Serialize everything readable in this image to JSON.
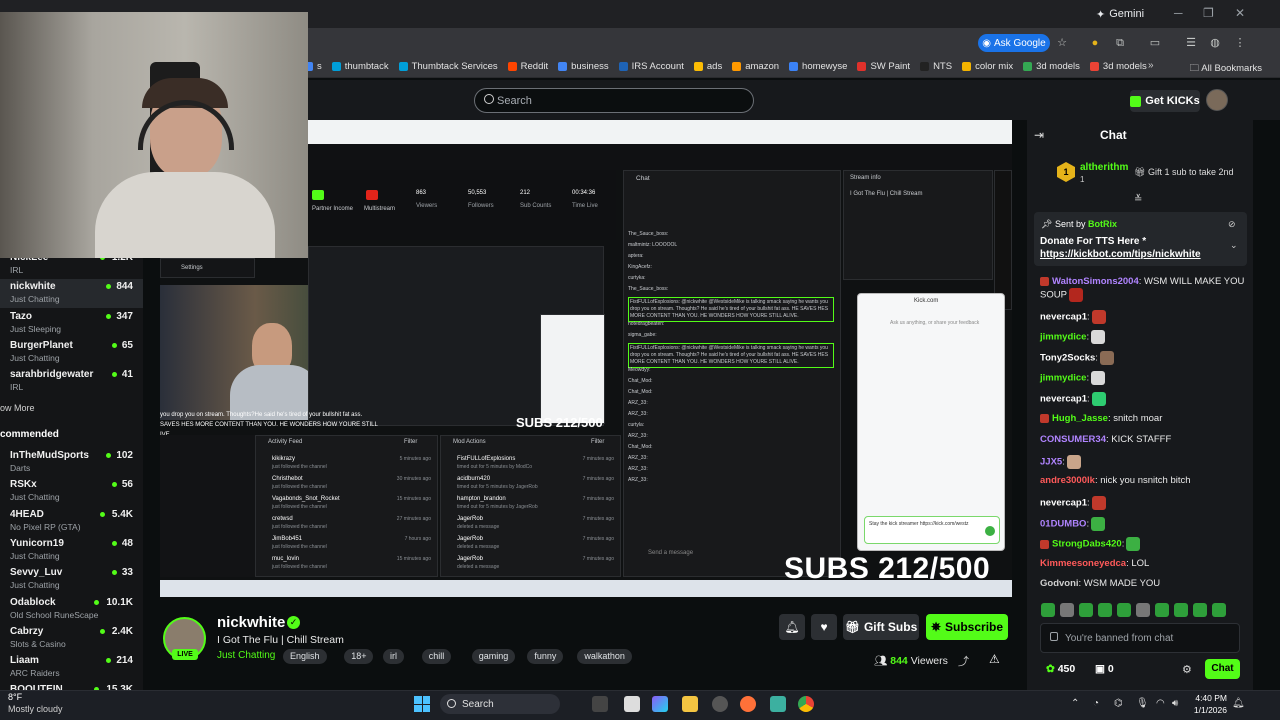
{
  "browser": {
    "gemini": "Gemini",
    "ask_google": "Ask Google",
    "bookmarks": [
      {
        "label": "s",
        "color": "#4285f4"
      },
      {
        "label": "thumbtack",
        "color": "#009fd9"
      },
      {
        "label": "Thumbtack Services",
        "color": "#009fd9"
      },
      {
        "label": "Reddit",
        "color": "#ff4500"
      },
      {
        "label": "business",
        "color": "#4285f4"
      },
      {
        "label": "IRS Account",
        "color": "#1e63b5"
      },
      {
        "label": "ads",
        "color": "#fbbc04"
      },
      {
        "label": "amazon",
        "color": "#ff9900"
      },
      {
        "label": "homewyse",
        "color": "#3b82f6"
      },
      {
        "label": "SW Paint",
        "color": "#e0312b"
      },
      {
        "label": "NTS",
        "color": "#222222"
      },
      {
        "label": "color mix",
        "color": "#f4b400"
      },
      {
        "label": "3d models",
        "color": "#34a853"
      },
      {
        "label": "3d models",
        "color": "#ea4335"
      }
    ],
    "all_bookmarks": "All Bookmarks"
  },
  "header": {
    "search_placeholder": "Search",
    "get_kicks": "Get KICKs"
  },
  "sidebar": {
    "following": [
      {
        "name": "NickLee",
        "category": "IRL",
        "viewers": "1.2K"
      },
      {
        "name": "nickwhite",
        "category": "Just Chatting",
        "viewers": "844"
      },
      {
        "name": "Tazo",
        "category": "Just Sleeping",
        "viewers": "347"
      },
      {
        "name": "BurgerPlanet",
        "category": "Just Chatting",
        "viewers": "65"
      },
      {
        "name": "sarahbridgewater",
        "category": "IRL",
        "viewers": "41"
      }
    ],
    "show_more": "ow More",
    "recommended_title": "commended",
    "recommended": [
      {
        "name": "InTheMudSports",
        "category": "Darts",
        "viewers": "102"
      },
      {
        "name": "RSKx",
        "category": "Just Chatting",
        "viewers": "56"
      },
      {
        "name": "4HEAD",
        "category": "No Pixel RP (GTA)",
        "viewers": "5.4K"
      },
      {
        "name": "Yunicorn19",
        "category": "Just Chatting",
        "viewers": "48"
      },
      {
        "name": "Sevvy_Luv",
        "category": "Just Chatting",
        "viewers": "33"
      },
      {
        "name": "Odablock",
        "category": "Old School RuneScape",
        "viewers": "10.1K"
      },
      {
        "name": "Cabrzy",
        "category": "Slots & Casino",
        "viewers": "2.4K"
      },
      {
        "name": "Liaam",
        "category": "ARC Raiders",
        "viewers": "214"
      },
      {
        "name": "BOOUTEIN",
        "category": "",
        "viewers": "15.3K"
      }
    ]
  },
  "video": {
    "subs_overlay": "SUBS 212/500",
    "subs_small": "SUBS 212/500",
    "stats": [
      {
        "value": "863",
        "label": "Viewers"
      },
      {
        "value": "50,553",
        "label": "Followers"
      },
      {
        "value": "212",
        "label": "Sub Counts"
      },
      {
        "value": "00:34:36",
        "label": "Time Live"
      }
    ],
    "partner_income": "Partner Income",
    "multistream": "Multistream",
    "settings": "Settings",
    "activity_feed": "Activity Feed",
    "mod_actions": "Mod Actions",
    "filter": "Filter",
    "chat": "Chat",
    "stream_info": "Stream info",
    "stream_info_title": "I Got The Flu | Chill Stream",
    "popup_url": "Kick.com",
    "popup_placeholder": "Ask us anything, or share your feedback",
    "popup_input": "Stay the kick streamer https://kick.com/westz",
    "send_message": "Send a message",
    "activity": [
      {
        "user": "kikikrazy",
        "action": "just followed the channel",
        "time": "5 minutes ago"
      },
      {
        "user": "Christhebot",
        "action": "just followed the channel",
        "time": "30 minutes ago"
      },
      {
        "user": "Vagabonds_Snot_Rocket",
        "action": "just followed the channel",
        "time": "15 minutes ago"
      },
      {
        "user": "cretwsd",
        "action": "just followed the channel",
        "time": "27 minutes ago"
      },
      {
        "user": "JimBob451",
        "action": "just followed the channel",
        "time": "7 hours ago"
      },
      {
        "user": "muc_lovin",
        "action": "just followed the channel",
        "time": "15 minutes ago"
      }
    ],
    "mod_log": [
      {
        "user": "FistFULLofExplosions",
        "action": "timed out for 5 minutes by ModCo",
        "time": "7 minutes ago"
      },
      {
        "user": "acidburn420",
        "action": "timed out for 5 minutes by JagerRob",
        "time": "7 minutes ago"
      },
      {
        "user": "hampton_brandon",
        "action": "timed out for 5 minutes by JagerRob",
        "time": "7 minutes ago"
      },
      {
        "user": "JagerRob",
        "action": "deleted a message",
        "time": "7 minutes ago"
      },
      {
        "user": "JagerRob",
        "action": "deleted a message",
        "time": "7 minutes ago"
      },
      {
        "user": "JagerRob",
        "action": "deleted a message",
        "time": "7 minutes ago"
      }
    ],
    "overlay_text_1": "you drop you on stream. Thoughts?He said he's tired of your bullshit fat ass.",
    "overlay_text_2": "SAVES HES MORE CONTENT THAN YOU. HE WONDERS HOW YOURE STILL",
    "overlay_text_3": "IVE.",
    "inner_chat": [
      "The_Sauce_boss:",
      "maltmintz: LOOOOOL",
      "aptera:",
      "KingAcefz:",
      "curtyka:",
      "The_Sauce_boss:",
      "FistFULLofExplosions: @nickwhite @WestsideMike is talking smack saying he wants you drop you on stream. Thoughts? He said he's tired of your bullshit fat ass. HE SAVES HES MORE CONTENT THAN YOU. HE WONDERS HOW YOURE STILL ALIVE.",
      "notedragbeaten:",
      "sigma_gabe:",
      "FistFULLofExplosions: @nickwhite @WestsideMike is talking smack saying he wants you drop you on stream. Thoughts? He said he's tired of your bullshit fat ass. HE SAVES HES MORE CONTENT THAN YOU. HE WONDERS HOW YOURE STILL ALIVE.",
      "Meowdyy:",
      "Chat_Mod:",
      "Chat_Mod:",
      "ARZ_33:",
      "ARZ_33:",
      "curtyla:",
      "ARZ_33:",
      "Chat_Mod:",
      "ARZ_33:",
      "ARZ_33:",
      "ARZ_33:"
    ]
  },
  "stream": {
    "live_badge": "LIVE",
    "streamer": "nickwhite",
    "title": "I Got The Flu | Chill Stream",
    "category": "Just Chatting",
    "tags": [
      "English",
      "18+",
      "irl",
      "chill",
      "gaming",
      "funny",
      "walkathon"
    ],
    "gift_subs": "Gift Subs",
    "subscribe": "Subscribe",
    "viewer_count": "844",
    "viewers_label": "Viewers"
  },
  "chat": {
    "title": "Chat",
    "gifter_name": "altherithm",
    "gifter_rank": "1",
    "gifter_count": "1",
    "gift_text": "Gift 1 sub to take 2nd",
    "pinned_sent_by": "Sent by",
    "pinned_bot": "BotRix",
    "pinned_line1": "Donate For TTS Here *",
    "pinned_line2": "https://kickbot.com/tips/nickwhite",
    "messages": [
      {
        "user": "WaltonSimons2004",
        "text": ": WSM WILL MAKE YOU SOUP",
        "color": "#b084ff",
        "emote": "#b3271e"
      },
      {
        "user": "nevercap1",
        "text": ":",
        "color": "#ffffff",
        "emote": "#c0392b"
      },
      {
        "user": "jimmydice",
        "text": ":",
        "color": "#53fc18",
        "emote": "#d9d9d9"
      },
      {
        "user": "Tony2Socks",
        "text": ":",
        "color": "#ffffff",
        "emote": "#8a6b55"
      },
      {
        "user": "jimmydice",
        "text": ":",
        "color": "#53fc18",
        "emote": "#d9d9d9"
      },
      {
        "user": "nevercap1",
        "text": ":",
        "color": "#ffffff",
        "emote": "#2ecc71"
      },
      {
        "user": "Hugh_Jasse",
        "text": ": snitch moar",
        "color": "#53fc18",
        "emote": ""
      },
      {
        "user": "CONSUMER34",
        "text": ": KICK STAFFF",
        "color": "#b084ff",
        "emote": ""
      },
      {
        "user": "JJX5",
        "text": ":",
        "color": "#b084ff",
        "emote": "#c9a58a"
      },
      {
        "user": "andre3000lk",
        "text": ": nick you nsnitch bitch",
        "color": "#ff5a5a",
        "emote": ""
      },
      {
        "user": "nevercap1",
        "text": ":",
        "color": "#ffffff",
        "emote": "#c0392b"
      },
      {
        "user": "01DUMBO",
        "text": ":",
        "color": "#b084ff",
        "emote": "#3cb043"
      },
      {
        "user": "StrongDabs420",
        "text": ":",
        "color": "#53fc18",
        "emote": "#3cb043"
      },
      {
        "user": "Kimmeesoneyedca",
        "text": ": LOL",
        "color": "#ff5a5a",
        "emote": ""
      },
      {
        "user": "Godvoni",
        "text": ": WSM MADE YOU",
        "color": "#d0d0d0",
        "emote": ""
      }
    ],
    "banned_placeholder": "You're banned from chat",
    "kicks_balance": "450",
    "badge_balance": "0",
    "chat_button": "Chat"
  },
  "taskbar": {
    "weather_temp": "8°F",
    "weather_desc": "Mostly cloudy",
    "search": "Search",
    "time": "4:40 PM",
    "date": "1/1/2026"
  }
}
